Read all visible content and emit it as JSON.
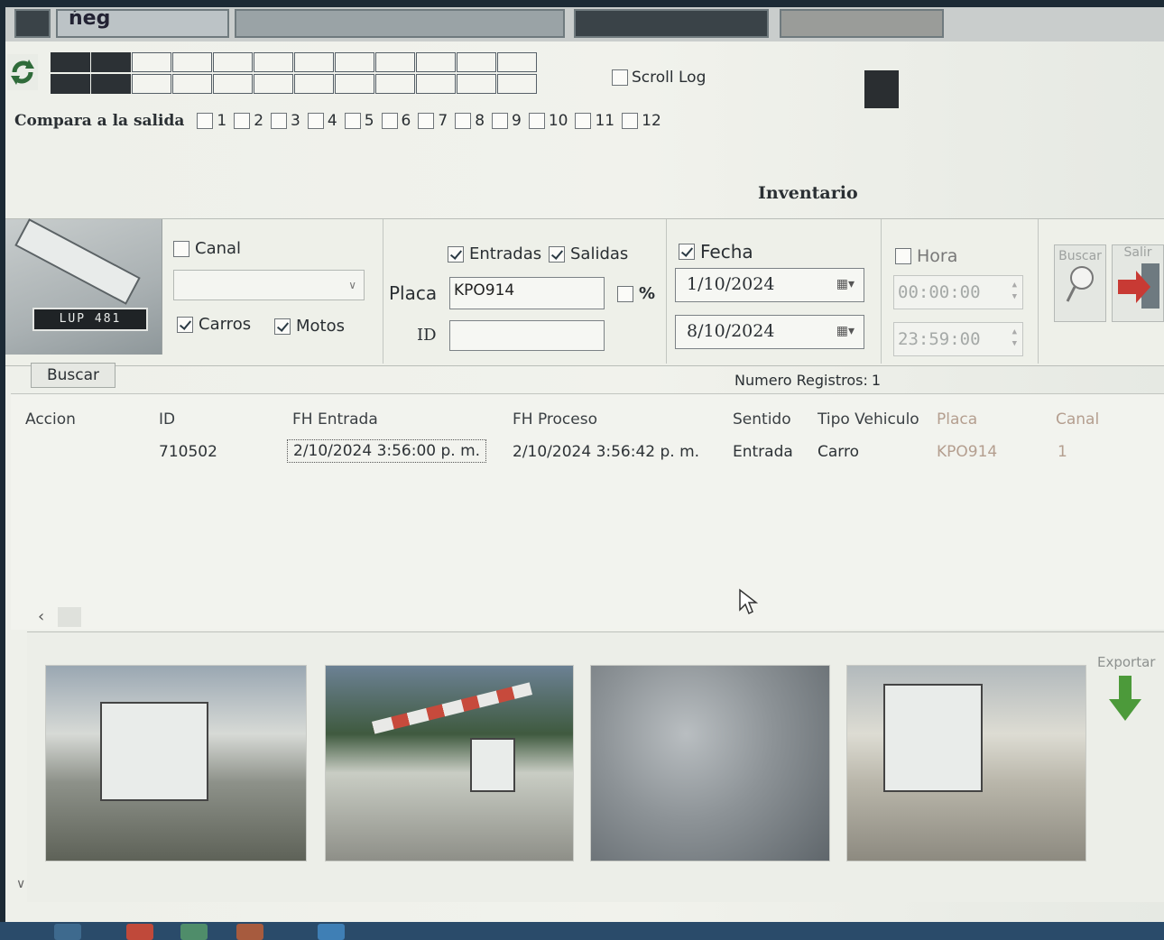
{
  "top_strip": {
    "label": "ńeg"
  },
  "scroll_log": {
    "label": "Scroll Log",
    "checked": false
  },
  "compara": {
    "label": "Compara a la salida",
    "options": [
      "1",
      "2",
      "3",
      "4",
      "5",
      "6",
      "7",
      "8",
      "9",
      "10",
      "11",
      "12"
    ]
  },
  "inventario": {
    "title": "Inventario"
  },
  "filters": {
    "camera_plate": "LUP 481",
    "canal": {
      "label": "Canal",
      "checked": false,
      "value": ""
    },
    "carros": {
      "label": "Carros",
      "checked": true
    },
    "motos": {
      "label": "Motos",
      "checked": true
    },
    "entradas": {
      "label": "Entradas",
      "checked": true
    },
    "salidas": {
      "label": "Salidas",
      "checked": true
    },
    "placa": {
      "label": "Placa",
      "value": "KPO914"
    },
    "percent": {
      "label": "%",
      "checked": false
    },
    "id": {
      "label": "ID",
      "value": ""
    },
    "fecha": {
      "label": "Fecha",
      "checked": true,
      "from": "1/10/2024",
      "to": "8/10/2024"
    },
    "hora": {
      "label": "Hora",
      "checked": false,
      "from": "00:00:00",
      "to": "23:59:00"
    },
    "buscar_big": "Buscar",
    "salir": "Salir"
  },
  "buscar_button": "Buscar",
  "num_registros": {
    "label": "Numero Registros:",
    "value": "1"
  },
  "table": {
    "headers": {
      "accion": "Accion",
      "id": "ID",
      "fh_entrada": "FH Entrada",
      "fh_proceso": "FH Proceso",
      "sentido": "Sentido",
      "tipo_vehiculo": "Tipo Vehiculo",
      "placa": "Placa",
      "canal": "Canal"
    },
    "rows": [
      {
        "accion": "",
        "id": "710502",
        "fh_entrada": "2/10/2024 3:56:00 p. m.",
        "fh_proceso": "2/10/2024 3:56:42 p. m.",
        "sentido": "Entrada",
        "tipo_vehiculo": "Carro",
        "placa": "KPO914",
        "canal": "1"
      }
    ]
  },
  "exportar": "Exportar",
  "colors": {
    "accent_green": "#4c9a3a",
    "salir_red": "#c83a34",
    "muted_text": "#b49e8f"
  }
}
